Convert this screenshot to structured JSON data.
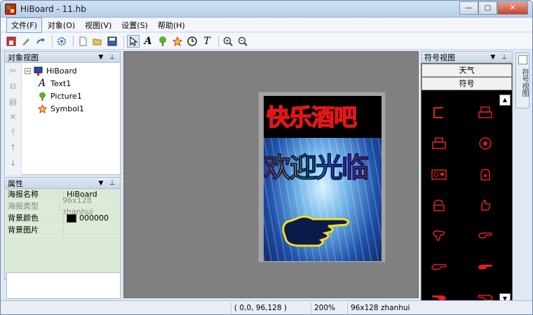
{
  "window": {
    "title": "HiBoard - 11.hb",
    "minimize": "—",
    "restore": "□",
    "close": "✕"
  },
  "menubar": [
    "文件(F)",
    "对象(O)",
    "视图(V)",
    "设置(S)",
    "帮助(H)"
  ],
  "object_view": {
    "title": "对象视图",
    "tree": {
      "root": {
        "label": "HiBoard",
        "icon": "board-icon"
      },
      "children": [
        {
          "label": "Text1",
          "icon": "text-icon"
        },
        {
          "label": "Picture1",
          "icon": "tree-icon"
        },
        {
          "label": "Symbol1",
          "icon": "star-icon"
        }
      ]
    }
  },
  "properties": {
    "title": "属性",
    "rows": [
      {
        "key": "海报名称",
        "value": "HiBoard",
        "dim": false
      },
      {
        "key": "海报类型",
        "value": "96x128 zhanhui",
        "dim": true
      },
      {
        "key": "背景颜色",
        "value": "000000",
        "dim": false,
        "swatch": "#000000"
      },
      {
        "key": "背景图片",
        "value": "",
        "dim": false
      }
    ]
  },
  "poster": {
    "text1": "快乐酒吧",
    "picture1": "欢迎光临"
  },
  "symbol_view": {
    "title": "符号视图",
    "tabs": [
      "天气",
      "符号"
    ]
  },
  "sidetab": {
    "label": "符号视图"
  },
  "status": {
    "coords": "( 0,0, 96,128 )",
    "zoom": "200%",
    "type": "96x128 zhanhui"
  },
  "colors": {
    "accent": "#e01818",
    "symbol": "#e02020",
    "canvas": "#808080"
  }
}
